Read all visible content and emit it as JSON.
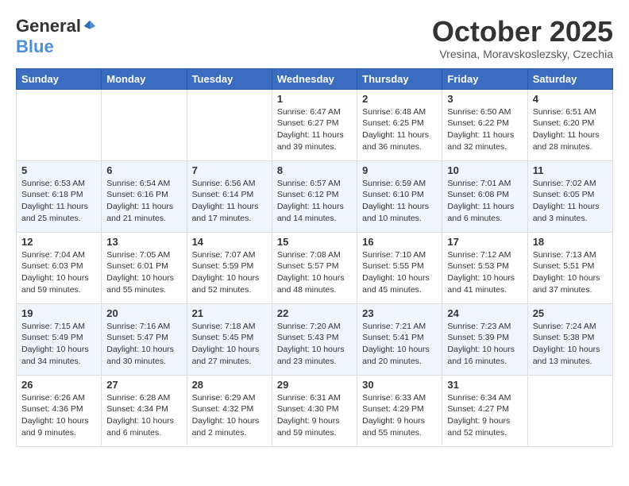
{
  "header": {
    "logo_general": "General",
    "logo_blue": "Blue",
    "month_title": "October 2025",
    "subtitle": "Vresina, Moravskoslezsky, Czechia"
  },
  "days_of_week": [
    "Sunday",
    "Monday",
    "Tuesday",
    "Wednesday",
    "Thursday",
    "Friday",
    "Saturday"
  ],
  "weeks": [
    [
      {
        "day": "",
        "info": ""
      },
      {
        "day": "",
        "info": ""
      },
      {
        "day": "",
        "info": ""
      },
      {
        "day": "1",
        "info": "Sunrise: 6:47 AM\nSunset: 6:27 PM\nDaylight: 11 hours\nand 39 minutes."
      },
      {
        "day": "2",
        "info": "Sunrise: 6:48 AM\nSunset: 6:25 PM\nDaylight: 11 hours\nand 36 minutes."
      },
      {
        "day": "3",
        "info": "Sunrise: 6:50 AM\nSunset: 6:22 PM\nDaylight: 11 hours\nand 32 minutes."
      },
      {
        "day": "4",
        "info": "Sunrise: 6:51 AM\nSunset: 6:20 PM\nDaylight: 11 hours\nand 28 minutes."
      }
    ],
    [
      {
        "day": "5",
        "info": "Sunrise: 6:53 AM\nSunset: 6:18 PM\nDaylight: 11 hours\nand 25 minutes."
      },
      {
        "day": "6",
        "info": "Sunrise: 6:54 AM\nSunset: 6:16 PM\nDaylight: 11 hours\nand 21 minutes."
      },
      {
        "day": "7",
        "info": "Sunrise: 6:56 AM\nSunset: 6:14 PM\nDaylight: 11 hours\nand 17 minutes."
      },
      {
        "day": "8",
        "info": "Sunrise: 6:57 AM\nSunset: 6:12 PM\nDaylight: 11 hours\nand 14 minutes."
      },
      {
        "day": "9",
        "info": "Sunrise: 6:59 AM\nSunset: 6:10 PM\nDaylight: 11 hours\nand 10 minutes."
      },
      {
        "day": "10",
        "info": "Sunrise: 7:01 AM\nSunset: 6:08 PM\nDaylight: 11 hours\nand 6 minutes."
      },
      {
        "day": "11",
        "info": "Sunrise: 7:02 AM\nSunset: 6:05 PM\nDaylight: 11 hours\nand 3 minutes."
      }
    ],
    [
      {
        "day": "12",
        "info": "Sunrise: 7:04 AM\nSunset: 6:03 PM\nDaylight: 10 hours\nand 59 minutes."
      },
      {
        "day": "13",
        "info": "Sunrise: 7:05 AM\nSunset: 6:01 PM\nDaylight: 10 hours\nand 55 minutes."
      },
      {
        "day": "14",
        "info": "Sunrise: 7:07 AM\nSunset: 5:59 PM\nDaylight: 10 hours\nand 52 minutes."
      },
      {
        "day": "15",
        "info": "Sunrise: 7:08 AM\nSunset: 5:57 PM\nDaylight: 10 hours\nand 48 minutes."
      },
      {
        "day": "16",
        "info": "Sunrise: 7:10 AM\nSunset: 5:55 PM\nDaylight: 10 hours\nand 45 minutes."
      },
      {
        "day": "17",
        "info": "Sunrise: 7:12 AM\nSunset: 5:53 PM\nDaylight: 10 hours\nand 41 minutes."
      },
      {
        "day": "18",
        "info": "Sunrise: 7:13 AM\nSunset: 5:51 PM\nDaylight: 10 hours\nand 37 minutes."
      }
    ],
    [
      {
        "day": "19",
        "info": "Sunrise: 7:15 AM\nSunset: 5:49 PM\nDaylight: 10 hours\nand 34 minutes."
      },
      {
        "day": "20",
        "info": "Sunrise: 7:16 AM\nSunset: 5:47 PM\nDaylight: 10 hours\nand 30 minutes."
      },
      {
        "day": "21",
        "info": "Sunrise: 7:18 AM\nSunset: 5:45 PM\nDaylight: 10 hours\nand 27 minutes."
      },
      {
        "day": "22",
        "info": "Sunrise: 7:20 AM\nSunset: 5:43 PM\nDaylight: 10 hours\nand 23 minutes."
      },
      {
        "day": "23",
        "info": "Sunrise: 7:21 AM\nSunset: 5:41 PM\nDaylight: 10 hours\nand 20 minutes."
      },
      {
        "day": "24",
        "info": "Sunrise: 7:23 AM\nSunset: 5:39 PM\nDaylight: 10 hours\nand 16 minutes."
      },
      {
        "day": "25",
        "info": "Sunrise: 7:24 AM\nSunset: 5:38 PM\nDaylight: 10 hours\nand 13 minutes."
      }
    ],
    [
      {
        "day": "26",
        "info": "Sunrise: 6:26 AM\nSunset: 4:36 PM\nDaylight: 10 hours\nand 9 minutes."
      },
      {
        "day": "27",
        "info": "Sunrise: 6:28 AM\nSunset: 4:34 PM\nDaylight: 10 hours\nand 6 minutes."
      },
      {
        "day": "28",
        "info": "Sunrise: 6:29 AM\nSunset: 4:32 PM\nDaylight: 10 hours\nand 2 minutes."
      },
      {
        "day": "29",
        "info": "Sunrise: 6:31 AM\nSunset: 4:30 PM\nDaylight: 9 hours\nand 59 minutes."
      },
      {
        "day": "30",
        "info": "Sunrise: 6:33 AM\nSunset: 4:29 PM\nDaylight: 9 hours\nand 55 minutes."
      },
      {
        "day": "31",
        "info": "Sunrise: 6:34 AM\nSunset: 4:27 PM\nDaylight: 9 hours\nand 52 minutes."
      },
      {
        "day": "",
        "info": ""
      }
    ]
  ]
}
